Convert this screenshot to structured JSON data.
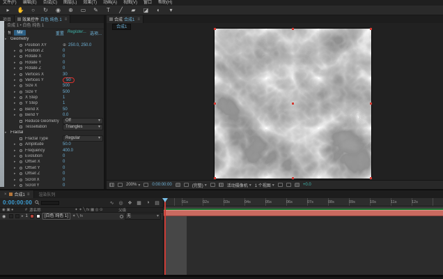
{
  "menu": {
    "items": [
      "文件(F)",
      "编辑(E)",
      "合成(C)",
      "图层(L)",
      "效果(T)",
      "动画(A)",
      "视图(V)",
      "窗口",
      "帮助(H)"
    ]
  },
  "toolbar": {
    "tools": [
      {
        "name": "selection-tool-icon",
        "glyph": "▸"
      },
      {
        "name": "hand-tool-icon",
        "glyph": "✋"
      },
      {
        "name": "zoom-tool-icon",
        "glyph": "○"
      },
      {
        "name": "orbit-camera-tool-icon",
        "glyph": "↻"
      },
      {
        "name": "camera-tool-icon",
        "glyph": "◉"
      },
      {
        "name": "pan-behind-tool-icon",
        "glyph": "⊕"
      },
      {
        "name": "shape-tool-icon",
        "glyph": "▭"
      },
      {
        "name": "pen-tool-icon",
        "glyph": "✎"
      },
      {
        "name": "type-tool-icon",
        "glyph": "T"
      },
      {
        "name": "brush-tool-icon",
        "glyph": "╱"
      },
      {
        "name": "clone-stamp-tool-icon",
        "glyph": "▰"
      },
      {
        "name": "eraser-tool-icon",
        "glyph": "◪"
      },
      {
        "name": "roto-brush-tool-icon",
        "glyph": "◐"
      },
      {
        "name": "puppet-pin-tool-icon",
        "glyph": "▾"
      }
    ]
  },
  "effect_controls": {
    "project_tab": "项目",
    "tab_label": "效果控件",
    "tab_target": "白色 纯色 1",
    "menu_glyph": "≡",
    "breadcrumb": "合成 1 • 白色 纯色 1",
    "effect": {
      "twirl": "▾",
      "badge": "fx",
      "name": "Mir",
      "reset_label": "重置",
      "register_label": "Register...",
      "options_label": "选项..."
    },
    "rows": [
      {
        "type": "group",
        "label": "Geometry",
        "value": ""
      },
      {
        "type": "point",
        "label": "Position XY",
        "value": "250.0, 250.0"
      },
      {
        "type": "number",
        "label": "Position Z",
        "value": "0"
      },
      {
        "type": "number",
        "label": "Rotate X",
        "value": "0"
      },
      {
        "type": "number",
        "label": "Rotate Y",
        "value": "0"
      },
      {
        "type": "number",
        "label": "Rotate Z",
        "value": "0"
      },
      {
        "type": "number",
        "label": "Vertices X",
        "value": "30"
      },
      {
        "type": "number",
        "label": "Vertices Y",
        "value": "50",
        "highlight": "red-circle"
      },
      {
        "type": "number",
        "label": "Size X",
        "value": "500"
      },
      {
        "type": "number",
        "label": "Size Y",
        "value": "500"
      },
      {
        "type": "number",
        "label": "X Step",
        "value": "1"
      },
      {
        "type": "number",
        "label": "Y Step",
        "value": "1"
      },
      {
        "type": "number",
        "label": "Bend X",
        "value": "50"
      },
      {
        "type": "number",
        "label": "Bend Y",
        "value": "0.0"
      },
      {
        "type": "dropdown",
        "label": "Reduce Geometry",
        "value": "Off"
      },
      {
        "type": "dropdown",
        "label": "Tessellation",
        "value": "Triangles"
      },
      {
        "type": "group",
        "label": "Fractal",
        "value": ""
      },
      {
        "type": "dropdown",
        "label": "Fractal Type",
        "value": "Regular"
      },
      {
        "type": "number",
        "label": "Amplitude",
        "value": "50.0"
      },
      {
        "type": "number",
        "label": "Frequency",
        "value": "400.0"
      },
      {
        "type": "number",
        "label": "Evolution",
        "value": "0"
      },
      {
        "type": "number",
        "label": "Offset X",
        "value": "0"
      },
      {
        "type": "number",
        "label": "Offset Y",
        "value": "0"
      },
      {
        "type": "number",
        "label": "Offset Z",
        "value": "0"
      },
      {
        "type": "number",
        "label": "Scroll X",
        "value": "0"
      },
      {
        "type": "number",
        "label": "Scroll Y",
        "value": "0"
      }
    ]
  },
  "comp_panel": {
    "tab_label": "合成",
    "tab_target": "合成1",
    "menu_glyph": "≡",
    "viewer_tab": "合成1",
    "toolbar": {
      "magnification": "200%",
      "timecode": "0:00:00:00",
      "resolution": "(完整)",
      "view": "活动摄像机",
      "layout": "1 个视图",
      "exposure": "+0.0"
    }
  },
  "timeline": {
    "tab": "合成1",
    "tab_close": "×",
    "tab2": "渲染队列",
    "menu_glyph": "≡",
    "timecode": "0:00:00:00",
    "icon_cluster": [
      "∿",
      "◎",
      "❖",
      "▦",
      "◑",
      "▤"
    ],
    "columns": {
      "toggles": "◉ ▣ ●",
      "number_sign": "#",
      "source_name": "源名称",
      "switches": "✦ ✶ ╲ fx ▦ ◎ ⊙",
      "parent": "父级"
    },
    "layer": {
      "eye": "◉",
      "twirl": "▸",
      "number": "1",
      "name": "[白色 纯色 1]",
      "switches": "✦ ╲ fx",
      "parent_value": "无"
    },
    "ruler_labels": [
      "01s",
      "02s",
      "03s",
      "04s",
      "05s",
      "06s",
      "07s",
      "08s",
      "09s",
      "10s",
      "11s",
      "12s"
    ]
  },
  "colors": {
    "accent_blue": "#6fb3d9",
    "timecode_blue": "#3d9fd6",
    "layer_bar": "#ca6a60",
    "work_area_green": "#1e7a33",
    "cti_red": "#cc3a33",
    "annotation_red": "#e0312d",
    "label_swatch_red": "#b5453c",
    "edge_strip": "#aab2b8"
  }
}
